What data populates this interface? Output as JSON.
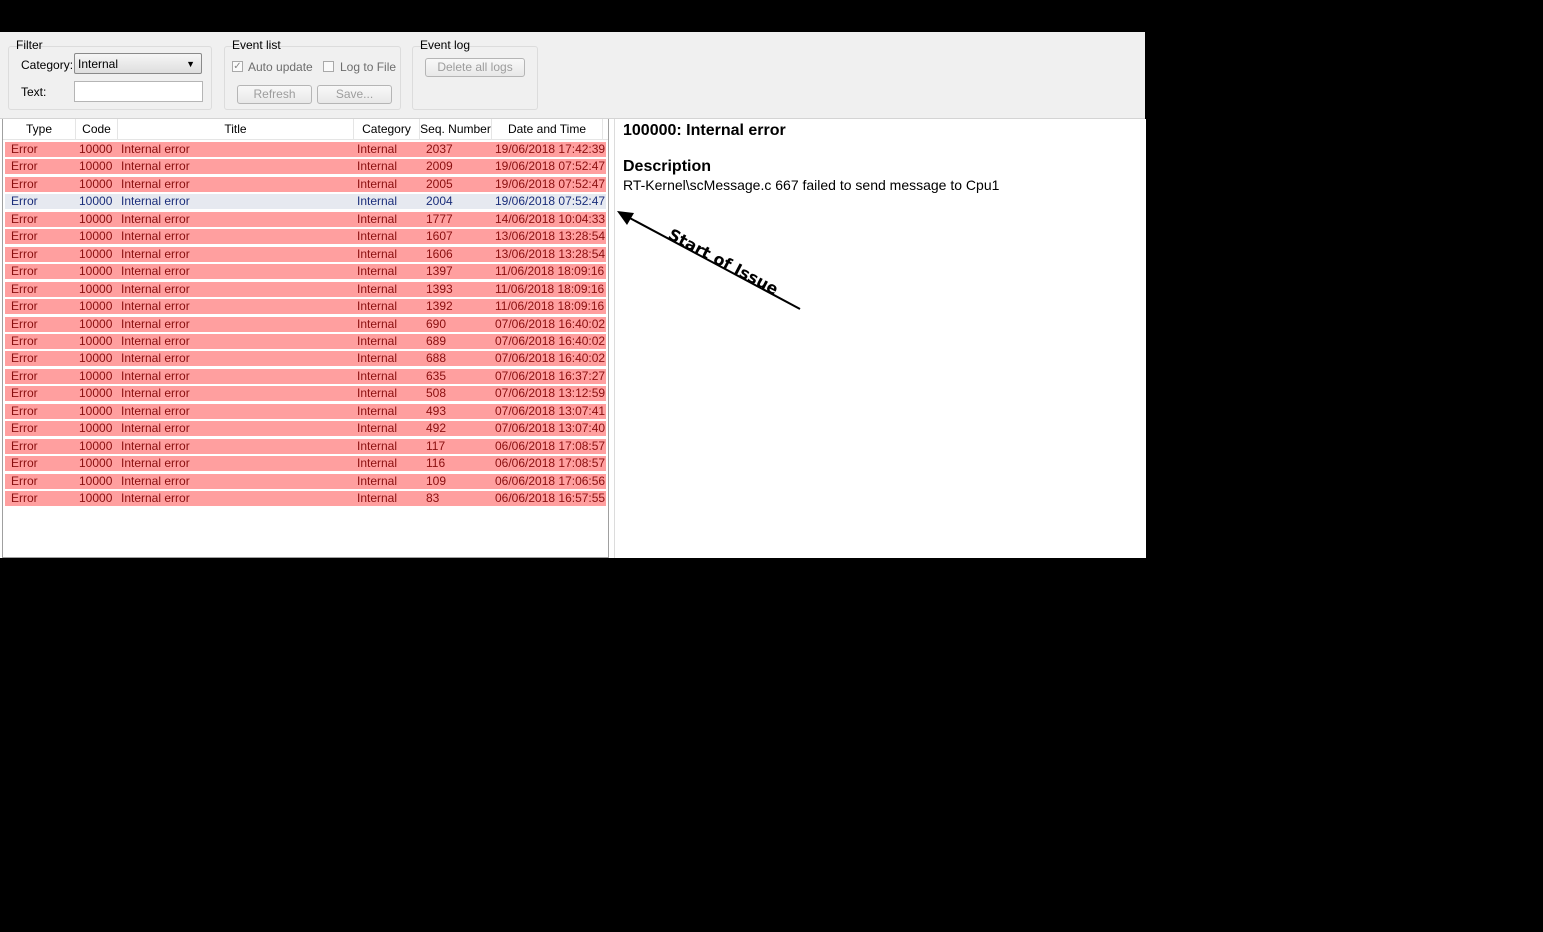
{
  "filter": {
    "title": "Filter",
    "category_label": "Category:",
    "category_value": "Internal",
    "text_label": "Text:",
    "text_value": ""
  },
  "event_list": {
    "title": "Event list",
    "auto_update_label": "Auto update",
    "auto_update_checked": true,
    "log_to_file_label": "Log to File",
    "log_to_file_checked": false,
    "refresh_label": "Refresh",
    "save_label": "Save..."
  },
  "event_log": {
    "title": "Event log",
    "delete_all_label": "Delete all logs"
  },
  "table": {
    "columns": [
      "Type",
      "Code",
      "Title",
      "Category",
      "Seq. Number",
      "Date and Time"
    ],
    "selected_index": 3,
    "rows": [
      [
        "Error",
        "10000",
        "Internal error",
        "Internal",
        "2037",
        "19/06/2018 17:42:39"
      ],
      [
        "Error",
        "10000",
        "Internal error",
        "Internal",
        "2009",
        "19/06/2018 07:52:47"
      ],
      [
        "Error",
        "10000",
        "Internal error",
        "Internal",
        "2005",
        "19/06/2018 07:52:47"
      ],
      [
        "Error",
        "10000",
        "Internal error",
        "Internal",
        "2004",
        "19/06/2018 07:52:47"
      ],
      [
        "Error",
        "10000",
        "Internal error",
        "Internal",
        "1777",
        "14/06/2018 10:04:33"
      ],
      [
        "Error",
        "10000",
        "Internal error",
        "Internal",
        "1607",
        "13/06/2018 13:28:54"
      ],
      [
        "Error",
        "10000",
        "Internal error",
        "Internal",
        "1606",
        "13/06/2018 13:28:54"
      ],
      [
        "Error",
        "10000",
        "Internal error",
        "Internal",
        "1397",
        "11/06/2018 18:09:16"
      ],
      [
        "Error",
        "10000",
        "Internal error",
        "Internal",
        "1393",
        "11/06/2018 18:09:16"
      ],
      [
        "Error",
        "10000",
        "Internal error",
        "Internal",
        "1392",
        "11/06/2018 18:09:16"
      ],
      [
        "Error",
        "10000",
        "Internal error",
        "Internal",
        "690",
        "07/06/2018 16:40:02"
      ],
      [
        "Error",
        "10000",
        "Internal error",
        "Internal",
        "689",
        "07/06/2018 16:40:02"
      ],
      [
        "Error",
        "10000",
        "Internal error",
        "Internal",
        "688",
        "07/06/2018 16:40:02"
      ],
      [
        "Error",
        "10000",
        "Internal error",
        "Internal",
        "635",
        "07/06/2018 16:37:27"
      ],
      [
        "Error",
        "10000",
        "Internal error",
        "Internal",
        "508",
        "07/06/2018 13:12:59"
      ],
      [
        "Error",
        "10000",
        "Internal error",
        "Internal",
        "493",
        "07/06/2018 13:07:41"
      ],
      [
        "Error",
        "10000",
        "Internal error",
        "Internal",
        "492",
        "07/06/2018 13:07:40"
      ],
      [
        "Error",
        "10000",
        "Internal error",
        "Internal",
        "117",
        "06/06/2018 17:08:57"
      ],
      [
        "Error",
        "10000",
        "Internal error",
        "Internal",
        "116",
        "06/06/2018 17:08:57"
      ],
      [
        "Error",
        "10000",
        "Internal error",
        "Internal",
        "109",
        "06/06/2018 17:06:56"
      ],
      [
        "Error",
        "10000",
        "Internal error",
        "Internal",
        "83",
        "06/06/2018 16:57:55"
      ]
    ]
  },
  "detail": {
    "title": "100000: Internal error",
    "description_heading": "Description",
    "description": "RT-Kernel\\scMessage.c 667 failed to send message to Cpu1"
  },
  "annotation": {
    "text": "Start of Issue"
  },
  "colors": {
    "error_row": "#ff9f9f",
    "error_text": "#8a0f0f",
    "selected_row": "#e6e9f0",
    "selected_text": "#1a2d7a",
    "toolbar_bg": "#f0f0f0"
  }
}
